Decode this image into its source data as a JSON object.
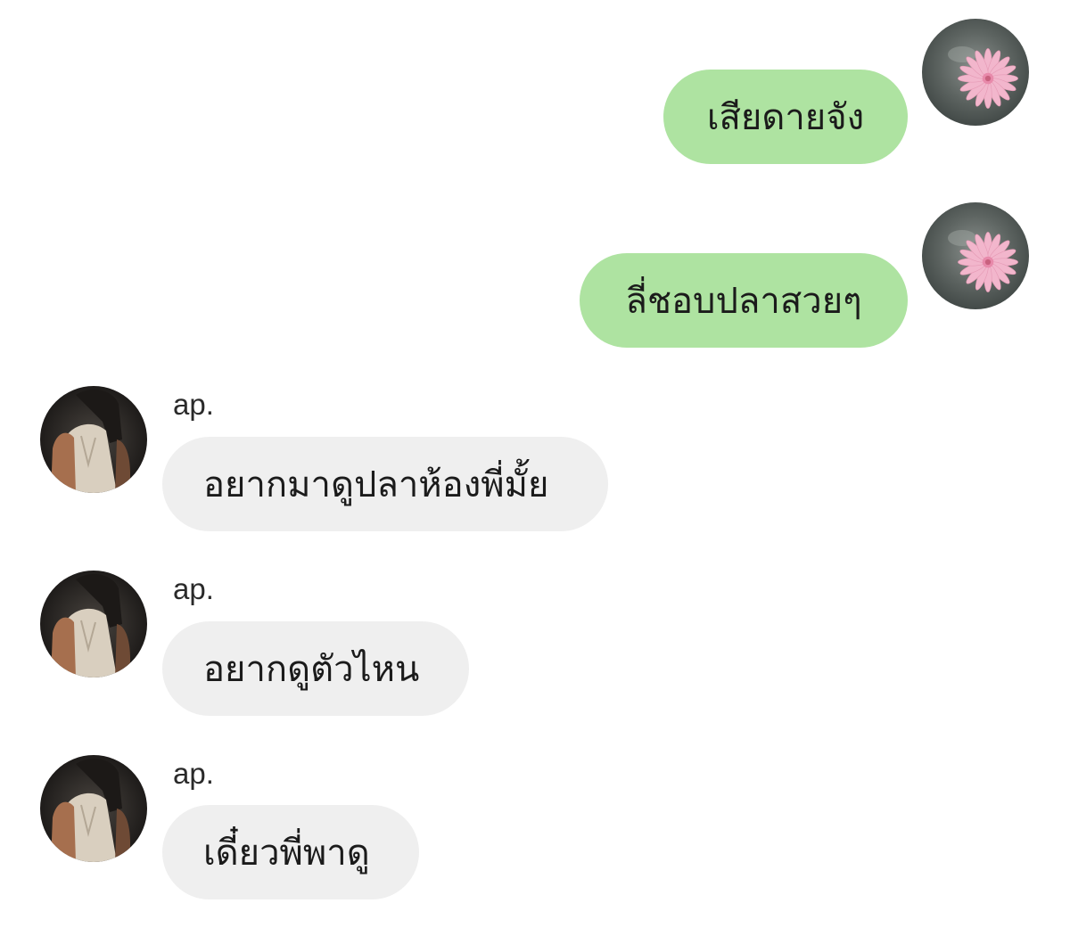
{
  "messages": [
    {
      "direction": "outgoing",
      "text": "เสียดายจัง",
      "avatar_icon": "pink-flower-avatar-icon"
    },
    {
      "direction": "outgoing",
      "text": "ลี่ชอบปลาสวยๆ",
      "avatar_icon": "pink-flower-avatar-icon"
    },
    {
      "direction": "incoming",
      "sender": "ap.",
      "text": "อยากมาดูปลาห้องพี่มั้ย",
      "avatar_icon": "person-avatar-icon"
    },
    {
      "direction": "incoming",
      "sender": "ap.",
      "text": "อยากดูตัวไหน",
      "avatar_icon": "person-avatar-icon"
    },
    {
      "direction": "incoming",
      "sender": "ap.",
      "text": "เดี๋ยวพี่พาดู",
      "avatar_icon": "person-avatar-icon"
    }
  ],
  "colors": {
    "outgoing_bubble": "#aee3a1",
    "incoming_bubble": "#efefef",
    "background": "#ffffff"
  }
}
